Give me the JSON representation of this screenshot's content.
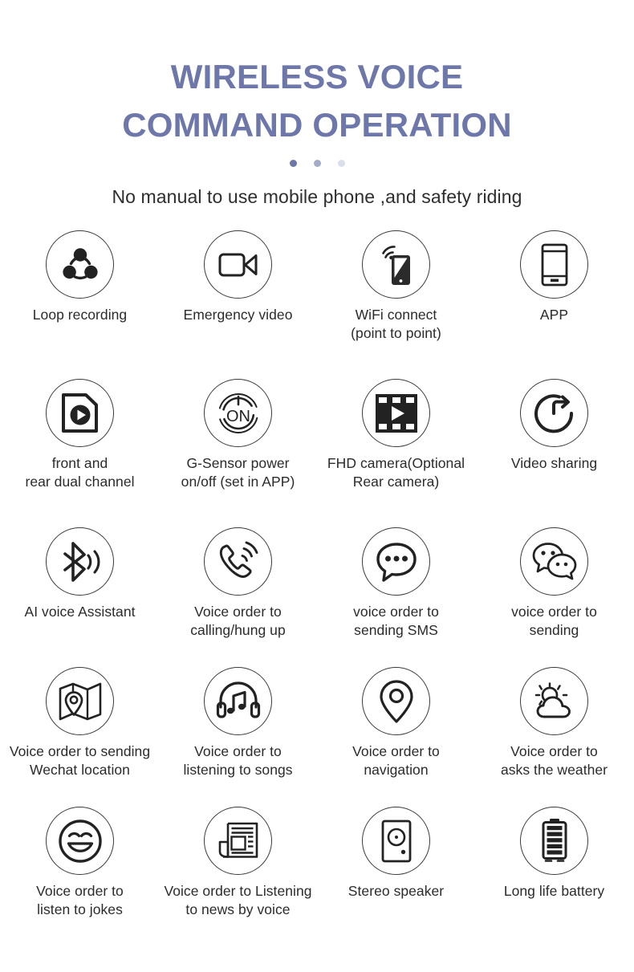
{
  "header": {
    "title_line1": "WIRELESS VOICE",
    "title_line2": "COMMAND OPERATION",
    "title_color": "#6d77aa",
    "subtitle": "No manual to use mobile phone ,and safety riding",
    "dots": [
      {
        "name": "dot-active",
        "color": "#6d77aa"
      },
      {
        "name": "dot-mid",
        "color": "#a3abc9"
      },
      {
        "name": "dot-faint",
        "color": "#dadeeb"
      }
    ]
  },
  "features": [
    {
      "icon": "loop-recording-icon",
      "label": "Loop recording"
    },
    {
      "icon": "camcorder-icon",
      "label": "Emergency video"
    },
    {
      "icon": "wifi-phone-icon",
      "label": "WiFi connect\n(point to point)"
    },
    {
      "icon": "smartphone-icon",
      "label": "APP"
    },
    {
      "icon": "video-file-play-icon",
      "label": "front and\nrear dual channel"
    },
    {
      "icon": "power-on-icon",
      "label": "G-Sensor power\non/off  (set in APP)"
    },
    {
      "icon": "film-strip-play-icon",
      "label": "FHD camera(Optional\nRear camera)"
    },
    {
      "icon": "share-circle-arrow-icon",
      "label": "Video sharing"
    },
    {
      "icon": "bluetooth-voice-icon",
      "label": "AI voice Assistant"
    },
    {
      "icon": "phone-call-icon",
      "label": "Voice order to\ncalling/hung up"
    },
    {
      "icon": "speech-bubble-icon",
      "label": "voice order to\nsending SMS"
    },
    {
      "icon": "wechat-bubbles-icon",
      "label": "voice order to\nsending"
    },
    {
      "icon": "map-pin-icon",
      "label": "Voice order to sending\nWechat location"
    },
    {
      "icon": "headphones-music-icon",
      "label": "Voice order to\nlistening to songs"
    },
    {
      "icon": "location-pin-icon",
      "label": "Voice order to\nnavigation"
    },
    {
      "icon": "sun-cloud-icon",
      "label": "Voice order to\nasks the weather"
    },
    {
      "icon": "smiley-face-icon",
      "label": "Voice order to\nlisten to jokes"
    },
    {
      "icon": "newspaper-icon",
      "label": "Voice order to Listening\nto news by voice"
    },
    {
      "icon": "speaker-icon",
      "label": "Stereo speaker"
    },
    {
      "icon": "battery-icon",
      "label": "Long life battery"
    }
  ]
}
